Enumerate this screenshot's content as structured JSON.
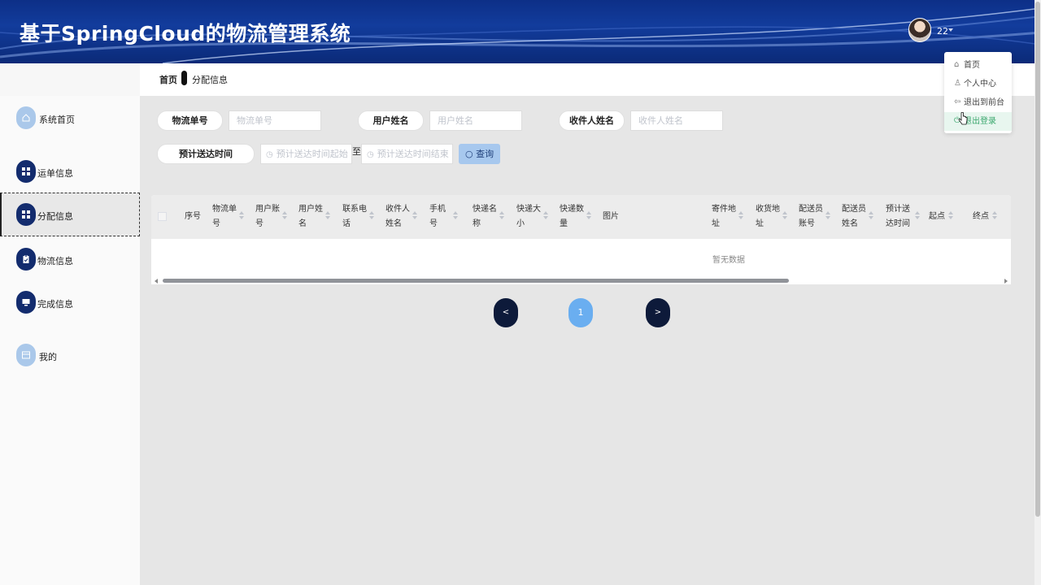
{
  "header": {
    "title": "基于SpringCloud的物流管理系统",
    "username": "22"
  },
  "user_menu": [
    {
      "label": "首页",
      "icon": "home-icon"
    },
    {
      "label": "个人中心",
      "icon": "user-icon"
    },
    {
      "label": "退出到前台",
      "icon": "back-arrow-icon"
    },
    {
      "label": "退出登录",
      "icon": "logout-icon"
    }
  ],
  "breadcrumb": {
    "home": "首页",
    "current": "分配信息"
  },
  "sidebar": {
    "items": [
      {
        "label": "系统首页",
        "icon": "home-icon"
      },
      {
        "label": "运单信息",
        "icon": "grid-icon"
      },
      {
        "label": "分配信息",
        "icon": "grid-icon"
      },
      {
        "label": "物流信息",
        "icon": "clipboard-icon"
      },
      {
        "label": "完成信息",
        "icon": "monitor-icon"
      },
      {
        "label": "我的",
        "icon": "profile-card-icon"
      }
    ]
  },
  "search": {
    "tracking_label": "物流单号",
    "tracking_placeholder": "物流单号",
    "username_label": "用户姓名",
    "username_placeholder": "用户姓名",
    "recipient_label": "收件人姓名",
    "recipient_placeholder": "收件人姓名",
    "eta_label": "预计送达时间",
    "eta_start_placeholder": "预计送达时间起始",
    "to_text": "至",
    "eta_end_placeholder": "预计送达时间结束",
    "search_button": "查询"
  },
  "table": {
    "columns": [
      [
        "序号"
      ],
      [
        "物流单",
        "号"
      ],
      [
        "用户账",
        "号"
      ],
      [
        "用户姓",
        "名"
      ],
      [
        "联系电",
        "话"
      ],
      [
        "收件人",
        "姓名"
      ],
      [
        "手机",
        "号"
      ],
      [
        "快递名",
        "称"
      ],
      [
        "快递大",
        "小"
      ],
      [
        "快递数",
        "量"
      ],
      [
        "图片"
      ],
      [
        "寄件地",
        "址"
      ],
      [
        "收货地",
        "址"
      ],
      [
        "配送员",
        "账号"
      ],
      [
        "配送员",
        "姓名"
      ],
      [
        "预计送",
        "达时间"
      ],
      [
        "起点"
      ],
      [
        "终点"
      ]
    ],
    "empty_text": "暂无数据"
  },
  "pagination": {
    "prev": "<",
    "current": "1",
    "next": ">"
  },
  "colors": {
    "header_blue": "#0d2f87",
    "nav_dark": "#132c6e",
    "nav_light": "#aac8ea",
    "page_active": "#6aaef0",
    "menu_active": "#3aa76d"
  }
}
